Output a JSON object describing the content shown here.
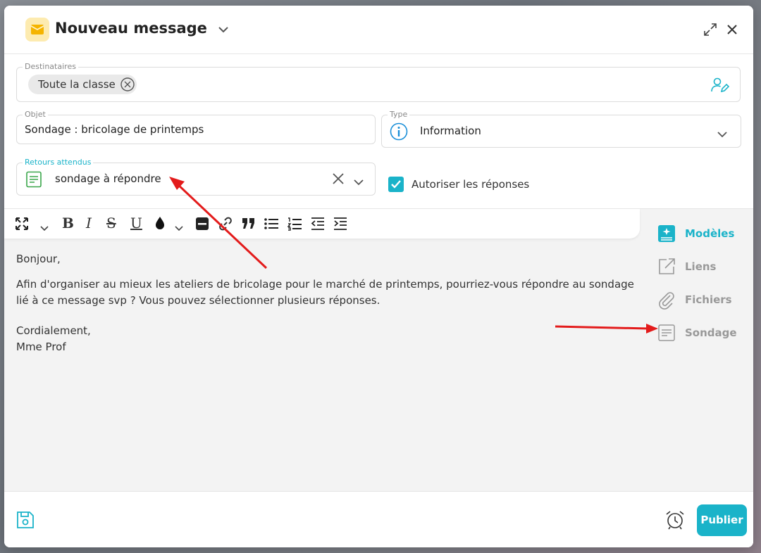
{
  "header": {
    "title": "Nouveau message"
  },
  "recipients": {
    "label": "Destinataires",
    "chip": "Toute la classe"
  },
  "subject": {
    "label": "Objet",
    "value": "Sondage : bricolage de printemps"
  },
  "type": {
    "label": "Type",
    "value": "Information"
  },
  "returns": {
    "label": "Retours attendus",
    "value": "sondage à répondre"
  },
  "allow_replies": {
    "label": "Autoriser les réponses",
    "checked": true
  },
  "body": {
    "greeting": "Bonjour,",
    "paragraph": "Afin d'organiser au mieux les ateliers de bricolage pour le marché de printemps, pourriez-vous répondre au sondage lié à ce message svp ? Vous pouvez sélectionner plusieurs réponses.",
    "closing": "Cordialement,",
    "signature": "Mme Prof"
  },
  "side_panel": {
    "items": [
      {
        "label": "Modèles",
        "icon": "templates-icon",
        "active": true
      },
      {
        "label": "Liens",
        "icon": "external-link-icon",
        "active": false
      },
      {
        "label": "Fichiers",
        "icon": "paperclip-icon",
        "active": false
      },
      {
        "label": "Sondage",
        "icon": "survey-icon",
        "active": false
      }
    ]
  },
  "footer": {
    "publish_label": "Publier"
  },
  "colors": {
    "accent": "#1ab3c9",
    "annotation": "#e31b1b",
    "mail_badge": "#fdebb0"
  }
}
